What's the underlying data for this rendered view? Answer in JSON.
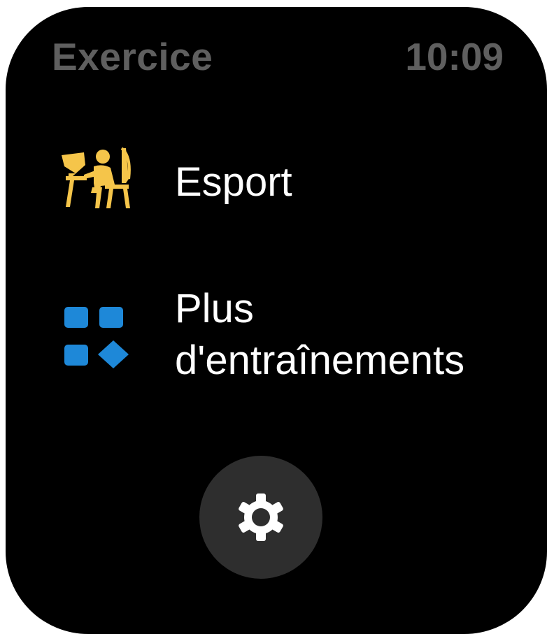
{
  "header": {
    "title": "Exercice",
    "time": "10:09"
  },
  "menu": {
    "items": [
      {
        "label": "Esport",
        "icon": "esport-player-icon",
        "color": "#f5c54a"
      },
      {
        "label": "Plus d'entraînements",
        "icon": "more-workouts-grid-icon",
        "color": "#1e88d8"
      }
    ]
  },
  "settings_button": {
    "icon": "gear-icon"
  },
  "colors": {
    "background": "#000000",
    "header_text": "#5f5f5f",
    "label_text": "#ffffff",
    "button_bg": "#2e2e2e"
  }
}
